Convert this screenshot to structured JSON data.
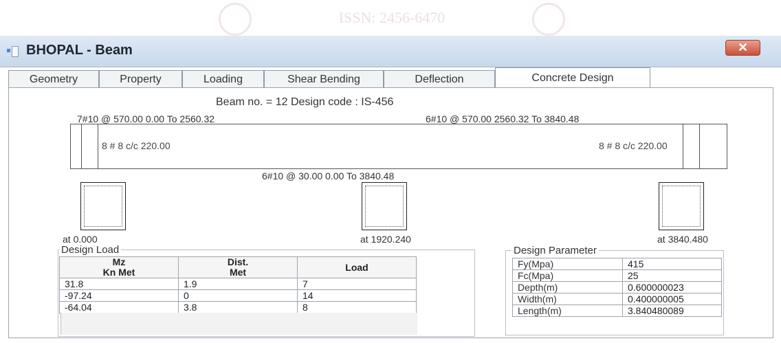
{
  "watermark": {
    "text": "ISSN: 2456-6470"
  },
  "window": {
    "title": "BHOPAL - Beam",
    "close_label": "✕"
  },
  "tabs": [
    {
      "label": "Geometry"
    },
    {
      "label": "Property"
    },
    {
      "label": "Loading"
    },
    {
      "label": "Shear Bending"
    },
    {
      "label": "Deflection"
    },
    {
      "label": "Concrete Design"
    }
  ],
  "design": {
    "heading": "Beam no. = 12  Design code :  IS-456",
    "top_left_reinforcement": "7#10 @ 570.00 0.00 To 2560.32",
    "top_right_reinforcement": "6#10 @ 570.00 2560.32 To 3840.48",
    "bottom_reinforcement": "6#10 @ 30.00 0.00 To 3840.48",
    "left_stirrups": "8 # 8 c/c 220.00",
    "right_stirrups": "8 # 8 c/c 220.00",
    "sections": [
      "at 0.000",
      "at 1920.240",
      "at 3840.480"
    ]
  },
  "design_load": {
    "title": "Design Load",
    "headers": [
      "Mz\nKn Met",
      "Dist.\nMet",
      "Load"
    ],
    "rows": [
      [
        "31.8",
        "1.9",
        "7"
      ],
      [
        "-97.24",
        "0",
        "14"
      ],
      [
        "-64.04",
        "3.8",
        "8"
      ]
    ]
  },
  "design_parameter": {
    "title": "Design Parameter",
    "rows": [
      [
        "Fy(Mpa)",
        "415"
      ],
      [
        "Fc(Mpa)",
        "25"
      ],
      [
        "Depth(m)",
        "0.600000023"
      ],
      [
        "Width(m)",
        "0.400000005"
      ],
      [
        "Length(m)",
        "3.840480089"
      ]
    ]
  }
}
